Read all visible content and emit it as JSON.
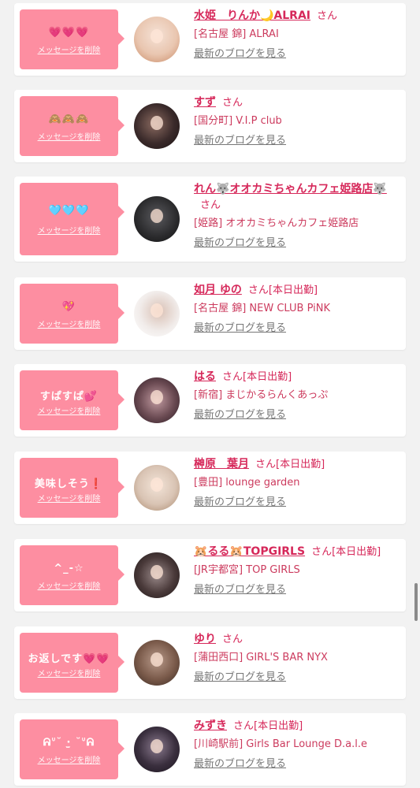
{
  "delete_label": "メッセージを削除",
  "san_label": "さん",
  "blog_label": "最新のブログを見る",
  "colors": {
    "accent_pink": "#fd8ea1",
    "name_red": "#d6285a",
    "link_gray": "#777777",
    "page_bg": "#f2f2f2"
  },
  "messages": [
    {
      "message": "💗💗💗",
      "name": "水姫　りんか🌙ALRAI",
      "tag": "",
      "shop": "[名古屋 錦] ALRAI",
      "avatar_color": "#f3d7c8"
    },
    {
      "message": "🙈🙈🙈",
      "name": "すず",
      "tag": "",
      "shop": "[国分町] V.I.P club",
      "avatar_color": "#3a2a2a"
    },
    {
      "message": "🩵🩵🩵",
      "name": "れん🐺オオカミちゃんカフェ姫路店🐺",
      "tag": "",
      "shop": "[姫路] オオカミちゃんカフェ姫路店",
      "avatar_color": "#2a2a2c"
    },
    {
      "message": "💖",
      "name": "如月 ゆの",
      "tag": "[本日出勤]",
      "shop": "[名古屋 錦] NEW CLUB PiNK",
      "avatar_color": "#ece7e4"
    },
    {
      "message": "すぱすぱ💕",
      "name": "はる",
      "tag": "[本日出勤]",
      "shop": "[新宿] まじかるらんくあっぷ",
      "avatar_color": "#6a4a52"
    },
    {
      "message": "美味しそう❗️",
      "name": "榊原　葉月",
      "tag": "[本日出勤]",
      "shop": "[豊田] lounge garden",
      "avatar_color": "#d9c4b4"
    },
    {
      "message": "^_-☆",
      "name": "🐹るる🐹TOPGIRLS",
      "tag": "[本日出勤]",
      "shop": "[JR宇都宮] TOP GIRLS",
      "avatar_color": "#4a3a3a"
    },
    {
      "message": "お返しです💗💗",
      "name": "ゆり",
      "tag": "",
      "shop": "[蒲田西口] GIRL'S BAR NYX",
      "avatar_color": "#7a5a4a"
    },
    {
      "message": "ᕱᐡ˘ ·̫ ˘ᐡᕱ",
      "name": "みずき",
      "tag": "[本日出勤]",
      "shop": "[川崎駅前] Girls Bar Lounge D.a.l.e",
      "avatar_color": "#3a2f3e"
    }
  ]
}
